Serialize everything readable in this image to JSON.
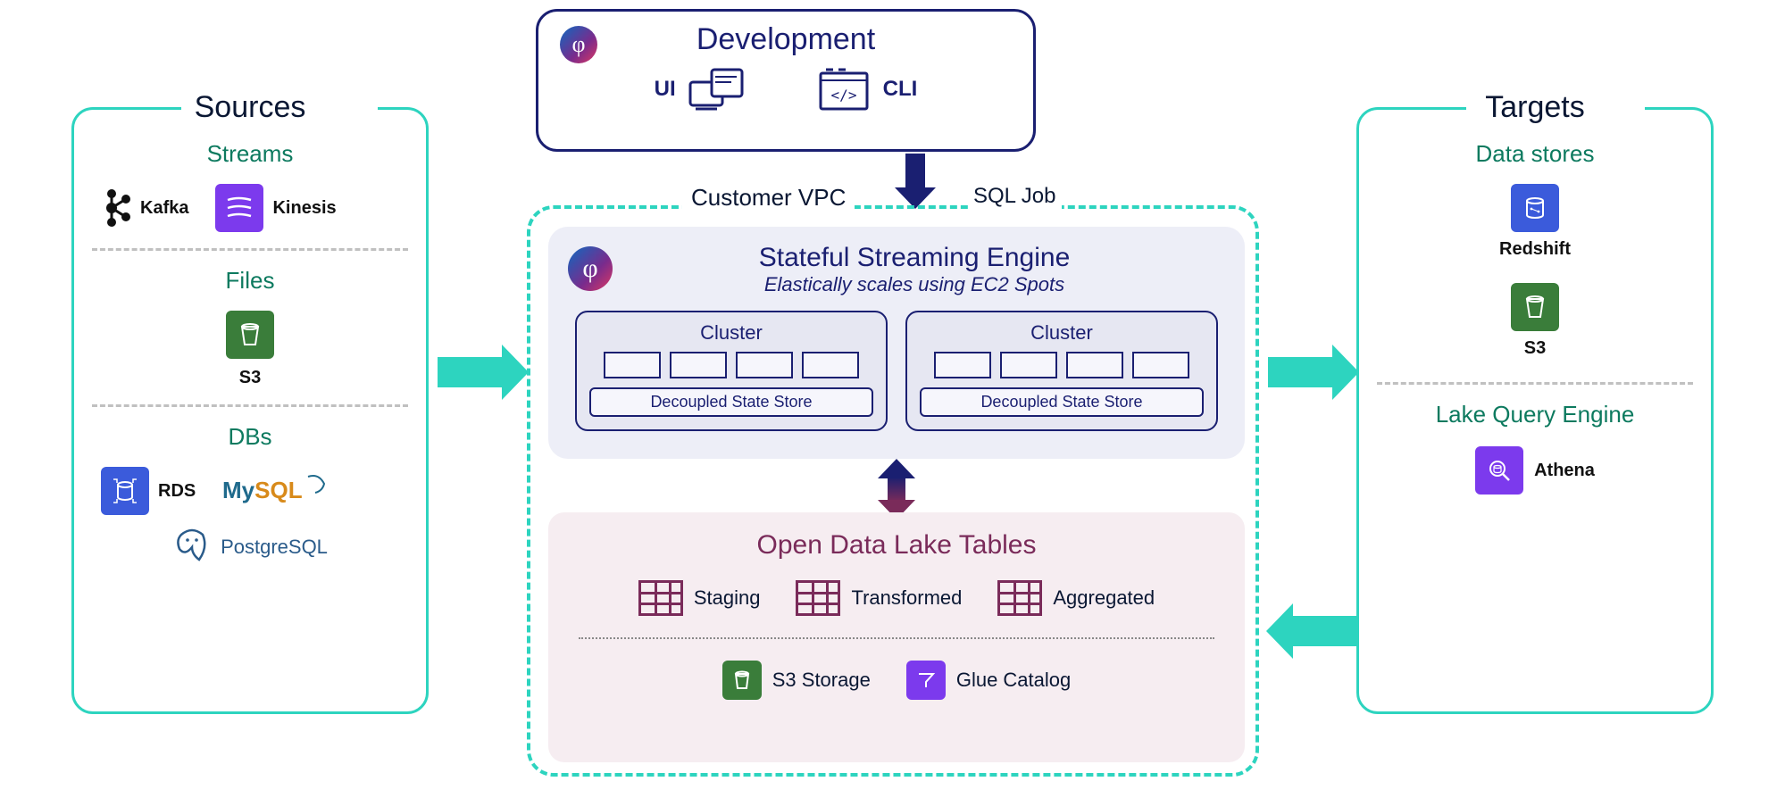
{
  "development": {
    "title": "Development",
    "ui_label": "UI",
    "cli_label": "CLI"
  },
  "sql_job_label": "SQL Job",
  "vpc_label": "Customer VPC",
  "sources": {
    "title": "Sources",
    "streams_title": "Streams",
    "kafka_label": "Kafka",
    "kinesis_label": "Kinesis",
    "files_title": "Files",
    "s3_label": "S3",
    "dbs_title": "DBs",
    "rds_label": "RDS",
    "mysql_label": "MySQL",
    "postgres_label": "PostgreSQL"
  },
  "engine": {
    "title": "Stateful Streaming Engine",
    "subtitle": "Elastically scales using EC2 Spots",
    "cluster_label": "Cluster",
    "state_store_label": "Decoupled State Store"
  },
  "lake": {
    "title": "Open Data Lake Tables",
    "staging": "Staging",
    "transformed": "Transformed",
    "aggregated": "Aggregated",
    "s3_storage": "S3 Storage",
    "glue_catalog": "Glue Catalog"
  },
  "targets": {
    "title": "Targets",
    "data_stores_title": "Data stores",
    "redshift_label": "Redshift",
    "s3_label": "S3",
    "lake_query_title": "Lake Query Engine",
    "athena_label": "Athena"
  }
}
